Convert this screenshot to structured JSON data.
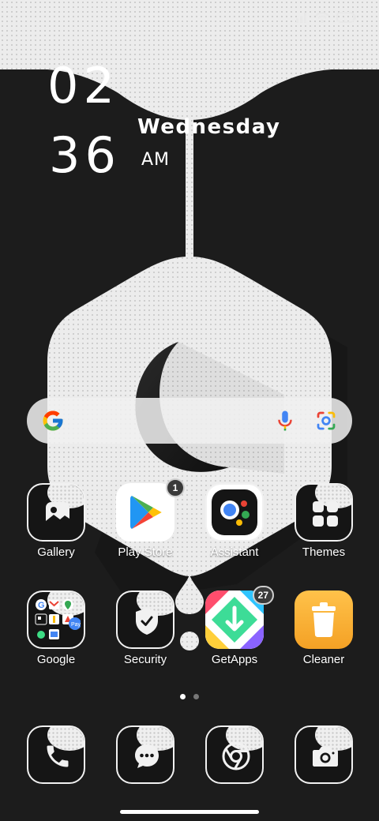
{
  "clock": {
    "hour": "02",
    "minute": "36",
    "day": "Wednesday",
    "ampm": "AM"
  },
  "search": {
    "g_icon": "google-g-icon",
    "mic_icon": "microphone-icon",
    "lens_icon": "google-lens-icon"
  },
  "apps_row1": [
    {
      "label": "Gallery",
      "icon": "gallery-icon"
    },
    {
      "label": "Play Store",
      "icon": "play-store-icon",
      "badge": "1"
    },
    {
      "label": "Assistant",
      "icon": "google-assistant-icon"
    },
    {
      "label": "Themes",
      "icon": "themes-icon"
    }
  ],
  "apps_row2": [
    {
      "label": "Google",
      "icon": "google-folder-icon"
    },
    {
      "label": "Security",
      "icon": "security-shield-icon"
    },
    {
      "label": "GetApps",
      "icon": "getapps-icon",
      "badge": "27"
    },
    {
      "label": "Cleaner",
      "icon": "cleaner-trash-icon"
    }
  ],
  "dock": [
    {
      "icon": "phone-icon"
    },
    {
      "icon": "messages-icon"
    },
    {
      "icon": "chrome-icon"
    },
    {
      "icon": "camera-icon"
    }
  ],
  "pager": {
    "pages": 2,
    "current": 1
  },
  "colors": {
    "wallpaper_dark": "#1c1c1c",
    "wallpaper_light": "#ececec",
    "cleaner": "#f7b538"
  }
}
